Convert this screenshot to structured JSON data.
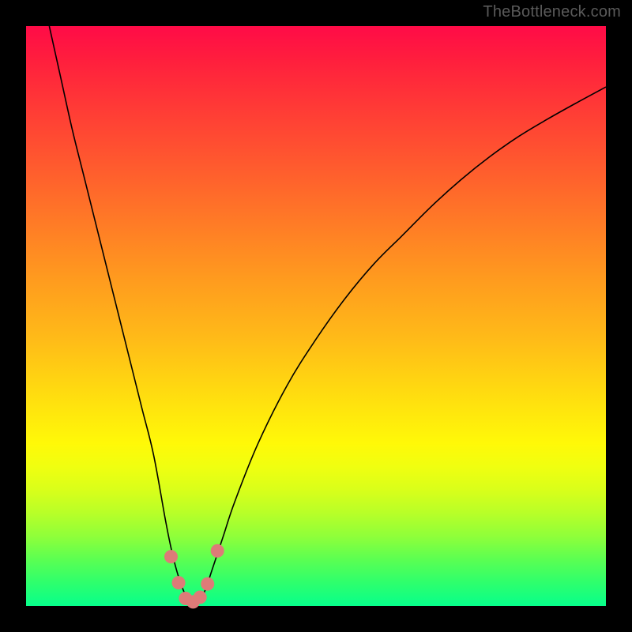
{
  "watermark": "TheBottleneck.com",
  "chart_data": {
    "type": "line",
    "title": "",
    "xlabel": "",
    "ylabel": "",
    "xlim": [
      0,
      100
    ],
    "ylim": [
      0,
      100
    ],
    "grid": false,
    "legend": false,
    "series": [
      {
        "name": "bottleneck-curve",
        "x": [
          4,
          6,
          8,
          10,
          12,
          14,
          16,
          18,
          20,
          22,
          24,
          25,
          26,
          27,
          28,
          29,
          30,
          31,
          32,
          34,
          36,
          40,
          45,
          50,
          55,
          60,
          65,
          70,
          75,
          80,
          85,
          90,
          95,
          100
        ],
        "y": [
          100,
          91,
          82,
          74,
          66,
          58,
          50,
          42,
          34,
          26,
          15,
          10,
          6,
          3,
          1,
          0.5,
          1,
          3,
          6,
          12,
          18,
          28,
          38,
          46,
          53,
          59,
          64,
          69,
          73.5,
          77.5,
          81,
          84,
          86.8,
          89.5
        ]
      }
    ],
    "markers": [
      {
        "name": "pt-1",
        "x": 25.0,
        "y": 8.5
      },
      {
        "name": "pt-2",
        "x": 26.3,
        "y": 4.0
      },
      {
        "name": "pt-3",
        "x": 27.5,
        "y": 1.3
      },
      {
        "name": "pt-4",
        "x": 28.8,
        "y": 0.7
      },
      {
        "name": "pt-5",
        "x": 30.0,
        "y": 1.5
      },
      {
        "name": "pt-6",
        "x": 31.3,
        "y": 3.8
      },
      {
        "name": "pt-7",
        "x": 33.0,
        "y": 9.5
      }
    ],
    "annotations": []
  },
  "colors": {
    "background": "#000000",
    "watermark": "#5a5a5a",
    "curve": "#000000",
    "marker": "#dd7b78",
    "gradient_stops": [
      "#ff0b47",
      "#ff7b26",
      "#ffde0f",
      "#5bff52",
      "#07ff8b"
    ]
  }
}
